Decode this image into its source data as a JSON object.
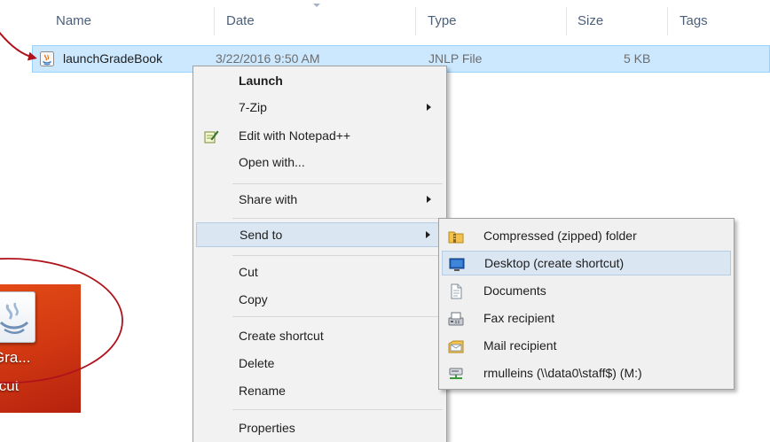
{
  "columns": {
    "name": "Name",
    "date": "Date",
    "type": "Type",
    "size": "Size",
    "tags": "Tags"
  },
  "file": {
    "name": "launchGradeBook",
    "date": "3/22/2016 9:50 AM",
    "type": "JNLP File",
    "size": "5 KB",
    "icon": "java-file-icon"
  },
  "context_menu": {
    "launch": "Launch",
    "seven_zip": "7-Zip",
    "edit_notepad": "Edit with Notepad++",
    "open_with": "Open with...",
    "share_with": "Share with",
    "send_to": "Send to",
    "cut": "Cut",
    "copy": "Copy",
    "create_shortcut": "Create shortcut",
    "delete": "Delete",
    "rename": "Rename",
    "properties": "Properties"
  },
  "send_to_menu": {
    "compressed": "Compressed (zipped) folder",
    "desktop": "Desktop (create shortcut)",
    "documents": "Documents",
    "fax": "Fax recipient",
    "mail": "Mail recipient",
    "network_drive": "rmulleins (\\\\data0\\staff$) (M:)"
  },
  "desktop_shortcut": {
    "label_line1": "Gra...",
    "label_line2": "tcut",
    "background": "#d33a12"
  },
  "colors": {
    "selection_fill": "#cce8ff",
    "menu_highlight": "#dae6f2",
    "annotation": "#b0121b",
    "header_text": "#4c607a"
  }
}
